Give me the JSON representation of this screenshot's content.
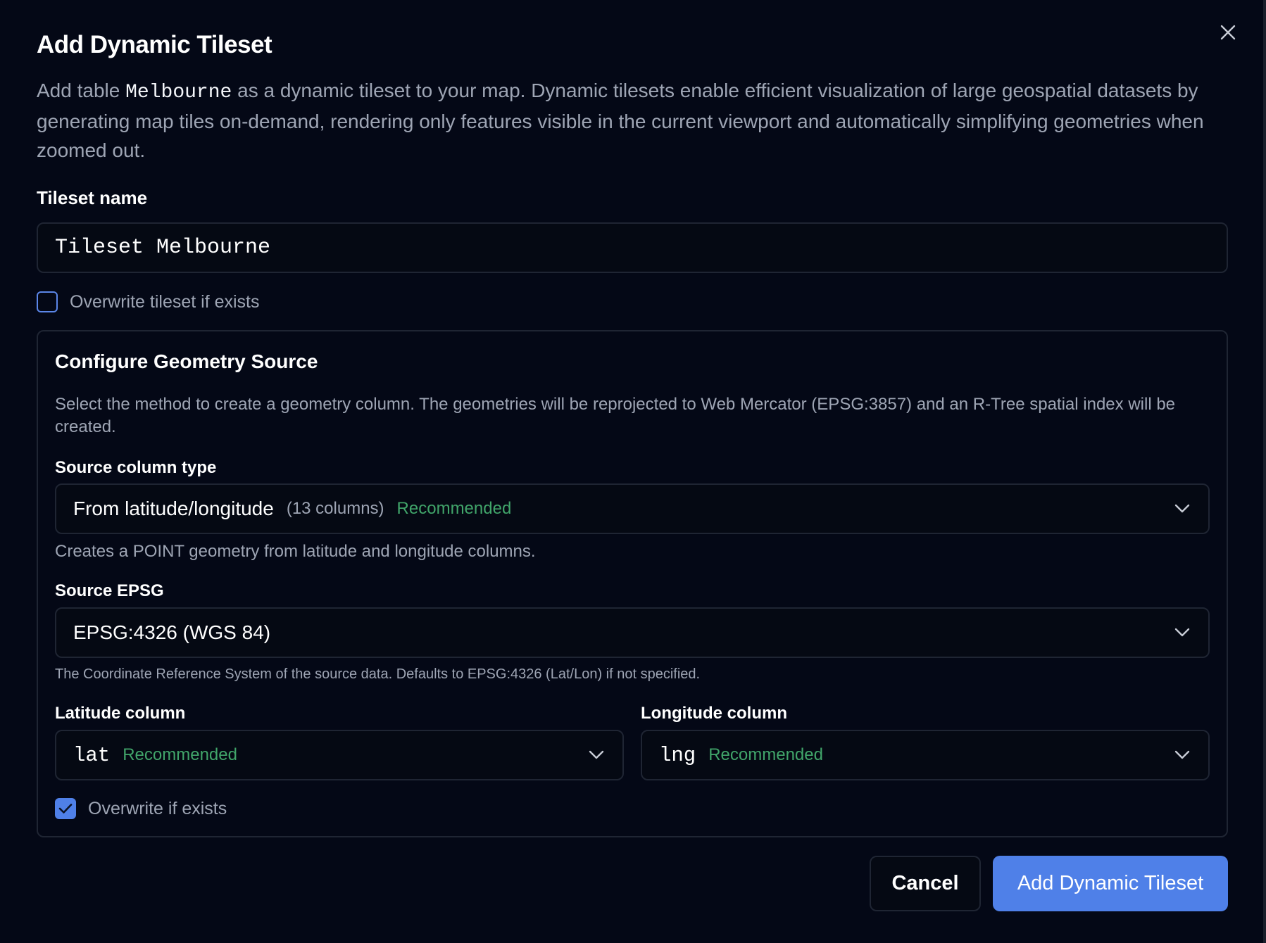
{
  "dialog": {
    "title": "Add Dynamic Tileset",
    "close_icon": "close-icon",
    "description_prefix": "Add table ",
    "table_name": "Melbourne",
    "description_suffix": " as a dynamic tileset to your map. Dynamic tilesets enable efficient visualization of large geospatial datasets by generating map tiles on-demand, rendering only features visible in the current viewport and automatically simplifying geometries when zoomed out."
  },
  "tileset_name": {
    "label": "Tileset name",
    "value": "Tileset Melbourne"
  },
  "overwrite_tileset": {
    "label": "Overwrite tileset if exists",
    "checked": false
  },
  "geometry": {
    "title": "Configure Geometry Source",
    "description": "Select the method to create a geometry column. The geometries will be reprojected to Web Mercator (EPSG:3857) and an R-Tree spatial index will be created.",
    "source_type": {
      "label": "Source column type",
      "value": "From latitude/longitude",
      "count": "(13 columns)",
      "badge": "Recommended",
      "helper": "Creates a POINT geometry from latitude and longitude columns."
    },
    "epsg": {
      "label": "Source EPSG",
      "value": "EPSG:4326 (WGS 84)",
      "helper": "The Coordinate Reference System of the source data. Defaults to EPSG:4326 (Lat/Lon) if not specified."
    },
    "latitude": {
      "label": "Latitude column",
      "value": "lat",
      "badge": "Recommended"
    },
    "longitude": {
      "label": "Longitude column",
      "value": "lng",
      "badge": "Recommended"
    },
    "overwrite": {
      "label": "Overwrite if exists",
      "checked": true
    }
  },
  "actions": {
    "cancel": "Cancel",
    "submit": "Add Dynamic Tileset"
  },
  "colors": {
    "background": "#040816",
    "accent": "#4f80e8",
    "recommended": "#41a56a",
    "muted_text": "#9ea5b4",
    "border": "#1f2533"
  }
}
